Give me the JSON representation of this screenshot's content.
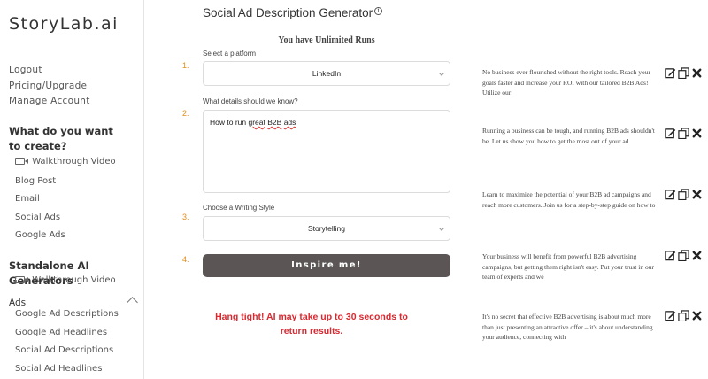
{
  "sidebar": {
    "logo": "StoryLab.ai",
    "account_links": [
      "Logout",
      "Pricing/Upgrade",
      "Manage Account"
    ],
    "section1_title": "What do you want to create?",
    "section1_items": [
      "Walkthrough Video",
      "Blog Post",
      "Email",
      "Social Ads",
      "Google Ads"
    ],
    "section2_title": "Standalone AI Generators",
    "section2_items": [
      "Walkthrough Video"
    ],
    "ads_group_label": "Ads",
    "ads_items": [
      "Google Ad Descriptions",
      "Google Ad Headlines",
      "Social Ad Descriptions",
      "Social Ad Headlines"
    ]
  },
  "main": {
    "title": "Social Ad Description Generator",
    "runs_notice": "You have Unlimited Runs",
    "steps": [
      "1.",
      "2.",
      "3.",
      "4."
    ],
    "platform_label": "Select a platform",
    "platform_value": "LinkedIn",
    "details_label": "What details should we know?",
    "details_words": [
      "How to run",
      "great",
      "B2B",
      "ads"
    ],
    "style_label": "Choose a Writing Style",
    "style_value": "Storytelling",
    "inspire_button": "Inspire me!",
    "wait_message": "Hang tight! AI may take up to 30 seconds to return results."
  },
  "results": [
    "No business ever flourished without the right tools. Reach your goals faster and increase your ROI with our tailored B2B Ads! Utilize our",
    "Running a business can be tough, and running B2B ads shouldn't be. Let us show you how to get the most out of your ad",
    "Learn to maximize the potential of your B2B ad campaigns and reach more customers. Join us for a step-by-step guide on how to",
    "Your business will benefit from powerful B2B advertising campaigns, but getting them right isn't easy. Put your trust in our team of experts and we",
    "It's no secret that effective B2B advertising is about much more than just presenting an attractive offer – it's about understanding your audience, connecting with"
  ],
  "icons": {
    "info": "info-icon",
    "video": "video-icon",
    "edit": "edit-icon",
    "copy": "copy-icon",
    "delete": "close-icon",
    "collapse": "chevron-up-icon"
  },
  "colors": {
    "step_number": "#e58e1a",
    "button_bg": "#5b5655",
    "wait_text": "#d9282f"
  }
}
